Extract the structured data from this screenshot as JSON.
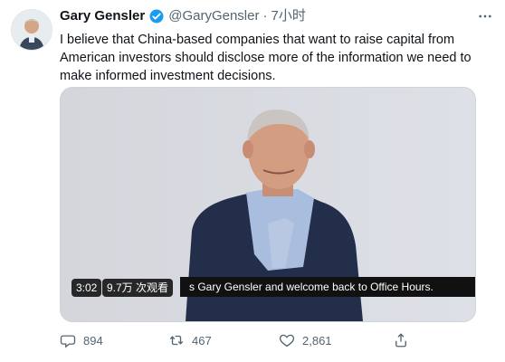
{
  "author": {
    "name": "Gary Gensler",
    "handle": "@GaryGensler",
    "separator": "·",
    "time": "7小时"
  },
  "tweet": {
    "text": "I believe that China-based companies that want to raise capital from American investors should disclose more of the information we need to make informed investment decisions."
  },
  "video": {
    "duration": "3:02",
    "views": "9.7万 次观看",
    "subtitle": "s Gary Gensler and welcome back to Office Hours."
  },
  "actions": {
    "replies": "894",
    "retweets": "467",
    "likes": "2,861"
  },
  "icons": {
    "verified": "verified-badge-icon",
    "more": "more-icon",
    "reply": "reply-icon",
    "retweet": "retweet-icon",
    "like": "heart-icon",
    "share": "share-icon"
  },
  "colors": {
    "verified_blue": "#1d9bf0",
    "secondary_text": "#536471"
  }
}
